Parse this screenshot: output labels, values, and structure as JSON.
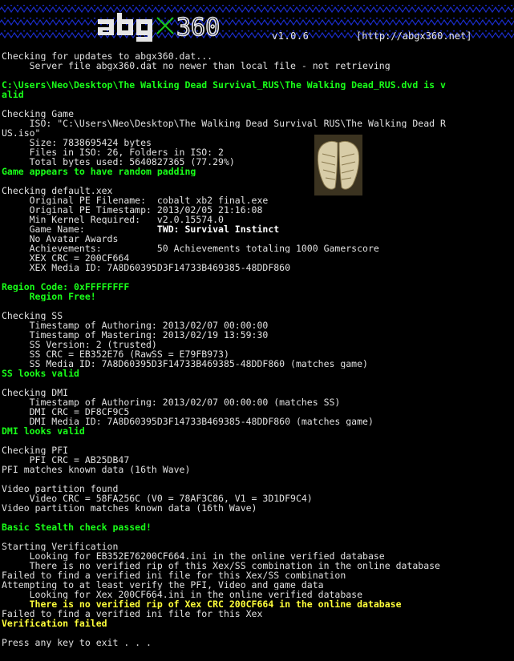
{
  "banner": {
    "logo_text": "abgx360",
    "version": "v1.0.6",
    "url": "[http://abgx360.net]"
  },
  "console": {
    "lines": [
      {
        "t": "Checking for updates to abgx360.dat...",
        "c": "w"
      },
      {
        "t": "     Server file abgx360.dat no newer than local file - not retrieving",
        "c": "w"
      },
      {
        "t": "",
        "c": "w"
      },
      {
        "t": "C:\\Users\\Neo\\Desktop\\The Walking Dead Survival_RUS\\The Walking Dead_RUS.dvd is v",
        "c": "g"
      },
      {
        "t": "alid",
        "c": "g"
      },
      {
        "t": "",
        "c": "w"
      },
      {
        "t": "Checking Game",
        "c": "w"
      },
      {
        "t": "     ISO: \"C:\\Users\\Neo\\Desktop\\The Walking Dead Survival_RUS\\The Walking Dead_R",
        "c": "w"
      },
      {
        "t": "US.iso\"",
        "c": "w"
      },
      {
        "t": "     Size: 7838695424 bytes",
        "c": "w"
      },
      {
        "t": "     Files in ISO: 26, Folders in ISO: 2",
        "c": "w"
      },
      {
        "t": "     Total bytes used: 5640827365 (77.29%)",
        "c": "w"
      },
      {
        "t": "Game appears to have random padding",
        "c": "g"
      },
      {
        "t": "",
        "c": "w"
      },
      {
        "t": "Checking default.xex",
        "c": "w"
      },
      {
        "t": "     Original PE Filename:  cobalt_xb2_final.exe",
        "c": "w"
      },
      {
        "t": "     Original PE Timestamp: 2013/02/05 21:16:08",
        "c": "w"
      },
      {
        "t": "     Min Kernel Required:   v2.0.15574.0",
        "c": "w"
      },
      {
        "t": "     Game Name:             TWD: Survival Instinct",
        "c": "mixed",
        "pre": "     Game Name:             ",
        "bold": "TWD: Survival Instinct"
      },
      {
        "t": "     No Avatar Awards",
        "c": "w"
      },
      {
        "t": "     Achievements:          50 Achievements totaling 1000 Gamerscore",
        "c": "w"
      },
      {
        "t": "     XEX CRC = 200CF664",
        "c": "w"
      },
      {
        "t": "     XEX Media ID: 7A8D60395D3F14733B469385-48DDF860",
        "c": "w"
      },
      {
        "t": "",
        "c": "w"
      },
      {
        "t": "Region Code: 0xFFFFFFFF",
        "c": "g"
      },
      {
        "t": "     Region Free!",
        "c": "g"
      },
      {
        "t": "",
        "c": "w"
      },
      {
        "t": "Checking SS",
        "c": "w"
      },
      {
        "t": "     Timestamp of Authoring: 2013/02/07 00:00:00",
        "c": "w"
      },
      {
        "t": "     Timestamp of Mastering: 2013/02/19 13:59:30",
        "c": "w"
      },
      {
        "t": "     SS Version: 2 (trusted)",
        "c": "w"
      },
      {
        "t": "     SS CRC = EB352E76 (RawSS = E79FB973)",
        "c": "w"
      },
      {
        "t": "     SS Media ID: 7A8D60395D3F14733B469385-48DDF860 (matches game)",
        "c": "w"
      },
      {
        "t": "SS looks valid",
        "c": "g"
      },
      {
        "t": "",
        "c": "w"
      },
      {
        "t": "Checking DMI",
        "c": "w"
      },
      {
        "t": "     Timestamp of Authoring: 2013/02/07 00:00:00 (matches SS)",
        "c": "w"
      },
      {
        "t": "     DMI CRC = DF8CF9C5",
        "c": "w"
      },
      {
        "t": "     DMI Media ID: 7A8D60395D3F14733B469385-48DDF860 (matches game)",
        "c": "w"
      },
      {
        "t": "DMI looks valid",
        "c": "g"
      },
      {
        "t": "",
        "c": "w"
      },
      {
        "t": "Checking PFI",
        "c": "w"
      },
      {
        "t": "     PFI CRC = AB25DB47",
        "c": "w"
      },
      {
        "t": "PFI matches known data (16th Wave)",
        "c": "w"
      },
      {
        "t": "",
        "c": "w"
      },
      {
        "t": "Video partition found",
        "c": "w"
      },
      {
        "t": "     Video CRC = 58FA256C (V0 = 78AF3C86, V1 = 3D1DF9C4)",
        "c": "w"
      },
      {
        "t": "Video partition matches known data (16th Wave)",
        "c": "w"
      },
      {
        "t": "",
        "c": "w"
      },
      {
        "t": "Basic Stealth check passed!",
        "c": "g"
      },
      {
        "t": "",
        "c": "w"
      },
      {
        "t": "Starting Verification",
        "c": "w"
      },
      {
        "t": "     Looking for EB352E76200CF664.ini in the online verified database",
        "c": "w"
      },
      {
        "t": "     There is no verified rip of this Xex/SS combination in the online database",
        "c": "w"
      },
      {
        "t": "Failed to find a verified ini file for this Xex/SS combination",
        "c": "w"
      },
      {
        "t": "Attempting to at least verify the PFI, Video and game data",
        "c": "w"
      },
      {
        "t": "     Looking for Xex_200CF664.ini in the online verified database",
        "c": "w"
      },
      {
        "t": "     There is no verified rip of Xex CRC 200CF664 in the online database",
        "c": "y"
      },
      {
        "t": "Failed to find a verified ini file for this Xex",
        "c": "w"
      },
      {
        "t": "Verification failed",
        "c": "y"
      },
      {
        "t": "",
        "c": "w"
      },
      {
        "t": "Press any key to exit . . .",
        "c": "w"
      }
    ]
  },
  "colors": {
    "green": "#19ff19",
    "yellow": "#ffff3a",
    "text": "#e0e0e0",
    "background": "#000000",
    "banner_blue": "#1a2ccc"
  },
  "icons": {
    "achievement_icon": "angel-wings-icon"
  }
}
